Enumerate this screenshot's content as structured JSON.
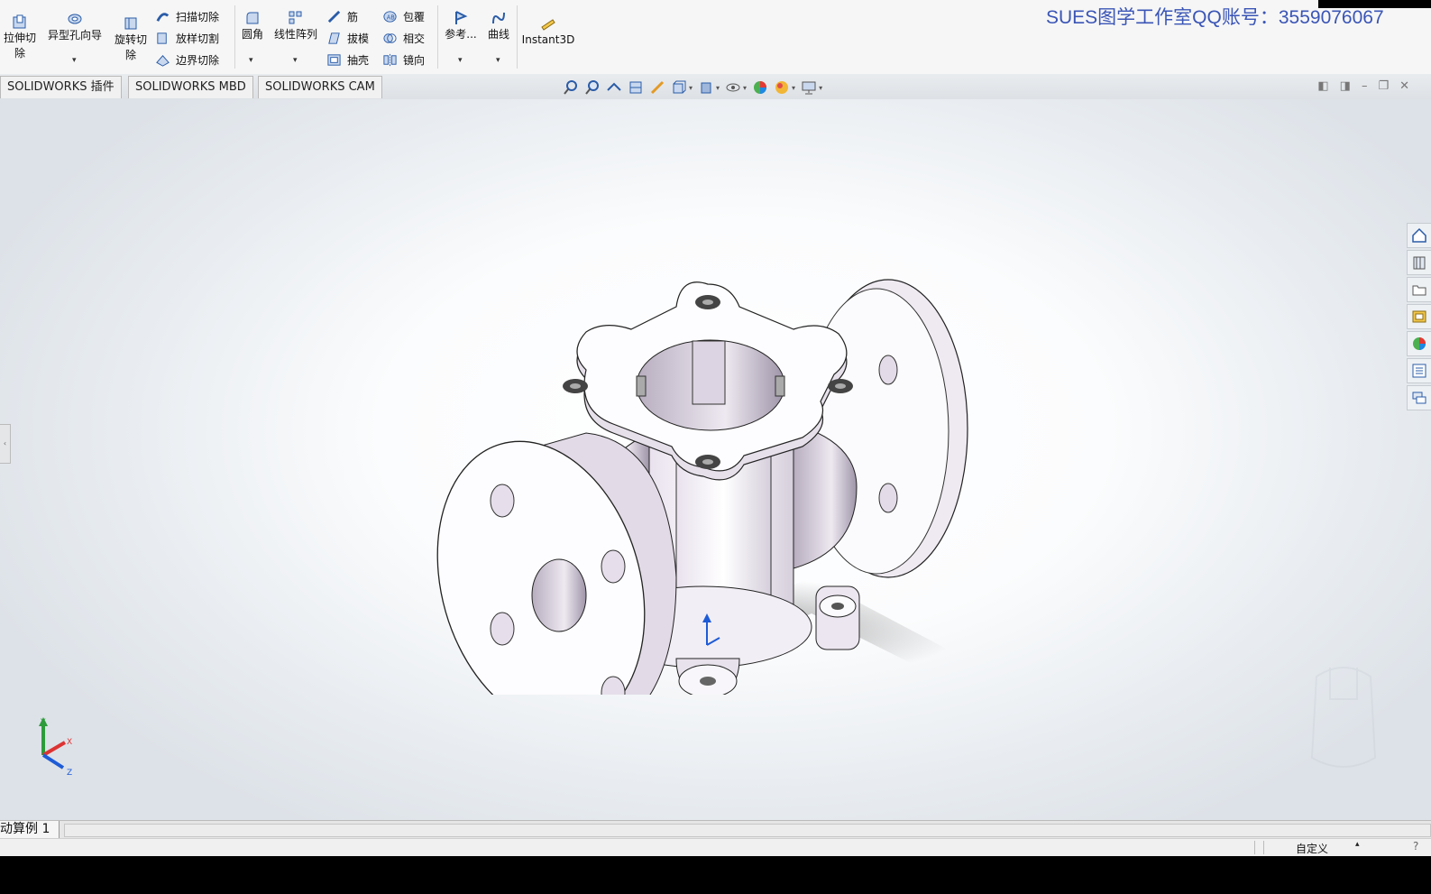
{
  "ribbon": {
    "extrude_cut": "拉伸切\n除",
    "hole_wizard": "异型孔向导",
    "revolve_cut": "旋转切\n除",
    "swept_cut": "扫描切除",
    "lofted_cut": "放样切割",
    "boundary_cut": "边界切除",
    "fillet": "圆角",
    "linear_pattern": "线性阵列",
    "rib": "筋",
    "draft": "拔模",
    "shell": "抽壳",
    "wrap": "包覆",
    "intersect": "相交",
    "mirror": "镜向",
    "reference": "参考...",
    "curves": "曲线",
    "instant3d": "Instant3D",
    "dropdown_glyph": "▾"
  },
  "watermark": "SUES图学工作室QQ账号：3559076067",
  "tabs": [
    "SOLIDWORKS 插件",
    "SOLIDWORKS MBD",
    "SOLIDWORKS CAM"
  ],
  "window_controls": [
    "◧",
    "◨",
    "–",
    "❐",
    "✕"
  ],
  "triad": {
    "x": "X",
    "y": "Y",
    "z": "Z"
  },
  "model_tab": "动算例 1",
  "status": {
    "custom": "自定义",
    "caret": "▴",
    "help": "?"
  },
  "colors": {
    "watermark": "#3a55b6",
    "accent_blue": "#1e5bd6"
  }
}
